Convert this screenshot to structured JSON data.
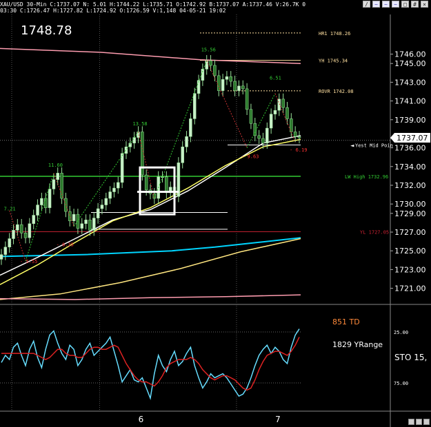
{
  "header": {
    "line1": "XAU/USD 30-Min  C:1737.07  N: 5.01  H:1744.22  L:1735.71  O:1742.92  B:1737.07  A:1737.46  V:26.7K  0",
    "line2": "03:30  C:1726.47  H:1727.82  L:1724.92  O:1726.59  V:1,148  04-05-21  19:02"
  },
  "window_icons": [
    "line-draw-icon",
    "indicator-icon",
    "indicator-icon",
    "indicator-icon",
    "square-icon",
    "grid-icon",
    "close-icon"
  ],
  "big_price": "1748.78",
  "indicator_notes": {
    "td": "851 TD",
    "yrange": "1829 YRange"
  },
  "chart_data": [
    {
      "type": "line",
      "title": "",
      "ylim": [
        1719.5,
        1749.5
      ],
      "y_ticks": [
        "1746.00",
        "1745.00",
        "1743.00",
        "1741.00",
        "1739.00",
        "1737.00",
        "1736.00",
        "1734.00",
        "1732.00",
        "1730.00",
        "1729.00",
        "1727.00",
        "1725.00",
        "1723.00",
        "1721.00"
      ],
      "x_ticks": [
        {
          "label": "6",
          "index": 34
        },
        {
          "label": "7",
          "index": 68
        }
      ],
      "n_bars": 75,
      "current_price": {
        "label": "1737.07",
        "value": 1737.07
      },
      "candles_close": [
        1724.6,
        1725.4,
        1726.3,
        1727.2,
        1727.8,
        1726.9,
        1726.4,
        1727.9,
        1728.8,
        1729.9,
        1730.6,
        1729.6,
        1731.6,
        1732.6,
        1733.3,
        1730.6,
        1729.2,
        1728.2,
        1728.9,
        1727.4,
        1727.9,
        1728.3,
        1727.2,
        1728.5,
        1729.5,
        1729.9,
        1730.6,
        1731.3,
        1731.7,
        1732.3,
        1735.4,
        1736.1,
        1736.5,
        1737.1,
        1737.7,
        1733.1,
        1731.5,
        1731.1,
        1730.6,
        1732.9,
        1732.9,
        1731.2,
        1731.8,
        1730.8,
        1734.4,
        1736.1,
        1737.2,
        1739.1,
        1741.8,
        1743.2,
        1744.4,
        1745.3,
        1744.8,
        1743.7,
        1742.1,
        1743.3,
        1743.6,
        1743.1,
        1742.1,
        1742.6,
        1742.3,
        1740.1,
        1738.6,
        1737.3,
        1737.0,
        1736.5,
        1738.1,
        1739.6,
        1740.0,
        1741.2,
        1740.3,
        1739.1,
        1737.7,
        1737.2,
        1737.07
      ],
      "series": [
        {
          "color": "#ff9db0",
          "values": [
            1746.6,
            1746.2,
            1745.4,
            1745.0
          ]
        },
        {
          "color": "#00d5ff",
          "values": [
            1724.4,
            1724.5,
            1724.6,
            1724.8,
            1725.0,
            1725.4,
            1725.9,
            1726.4
          ]
        },
        {
          "color": "#ffe680",
          "values": [
            1719.8,
            1720.4,
            1721.6,
            1723.1,
            1724.9,
            1726.3
          ]
        },
        {
          "color": "#ffffff",
          "values": [
            1722.4,
            1724.3,
            1726.3,
            1728.3,
            1729.4,
            1731.4,
            1733.9,
            1736.5,
            1737.3
          ]
        },
        {
          "color": "#ffff66",
          "values": [
            1721.4,
            1723.5,
            1725.9,
            1728.2,
            1729.6,
            1731.7,
            1734.1,
            1736.1,
            1736.9
          ]
        },
        {
          "color": "#ff9db0",
          "values": [
            1719.9,
            1719.8,
            1720.0,
            1720.1,
            1720.3
          ]
        }
      ],
      "levels": [
        {
          "label": "HR1 1748.26",
          "value": 1748.26,
          "color": "#ffe0a0"
        },
        {
          "label": "YH 1745.34",
          "value": 1745.34,
          "color": "#ffe0a0"
        },
        {
          "label": "ROVR 1742.08",
          "value": 1742.08,
          "color": "#ffe0a0"
        },
        {
          "label": "Yest Mid Poin",
          "value": 1736.3,
          "color": "#ffffff"
        },
        {
          "label": "LW High 1732.96",
          "value": 1732.96,
          "color": "#33cc33"
        },
        {
          "label": "YL 1727.05",
          "value": 1727.05,
          "color": "#cc2233"
        }
      ],
      "annotations": [
        {
          "text": "15.56",
          "x": 51,
          "y": 1746.3,
          "color": "#33cc33"
        },
        {
          "text": "6.51",
          "x": 68,
          "y": 1743.3,
          "color": "#33cc33"
        },
        {
          "text": "13.58",
          "x": 34,
          "y": 1738.4,
          "color": "#33cc33"
        },
        {
          "text": "11.60",
          "x": 13,
          "y": 1734.0,
          "color": "#33cc33"
        },
        {
          "text": "7.21",
          "x": 2,
          "y": 1729.3,
          "color": "#33cc33"
        },
        {
          "text": "- 9.63",
          "x": 61,
          "y": 1734.9,
          "color": "#ff3333"
        },
        {
          "text": "- 6.19",
          "x": 73,
          "y": 1735.6,
          "color": "#ff3333"
        },
        {
          "text": "- 8.35",
          "x": 15,
          "y": 1725.5,
          "color": "#ff3333"
        },
        {
          "text": "- 5.55",
          "x": 6,
          "y": 1723.7,
          "color": "#ff3333"
        }
      ]
    },
    {
      "type": "line",
      "title": "",
      "indicator": "STO",
      "y_ticks": [
        "25.00",
        "75.00"
      ],
      "axis_label": "STO  15,",
      "series": [
        {
          "color": "#66ddff",
          "values": [
            55,
            48,
            52,
            40,
            36,
            48,
            58,
            42,
            34,
            50,
            60,
            42,
            28,
            24,
            36,
            46,
            52,
            38,
            42,
            58,
            52,
            42,
            36,
            48,
            44,
            40,
            36,
            30,
            44,
            58,
            74,
            68,
            62,
            72,
            74,
            70,
            80,
            90,
            66,
            48,
            58,
            64,
            52,
            44,
            58,
            54,
            46,
            40,
            58,
            70,
            80,
            74,
            66,
            70,
            68,
            66,
            70,
            76,
            82,
            88,
            86,
            80,
            70,
            58,
            48,
            42,
            38,
            46,
            40,
            44,
            52,
            56,
            40,
            28,
            22
          ]
        },
        {
          "color": "#dd2222",
          "values": [
            46,
            46,
            46,
            46,
            46,
            46,
            46,
            46,
            46,
            48,
            50,
            52,
            50,
            46,
            42,
            42,
            46,
            48,
            48,
            50,
            50,
            46,
            42,
            40,
            40,
            42,
            42,
            40,
            38,
            40,
            48,
            56,
            62,
            68,
            72,
            74,
            74,
            76,
            78,
            74,
            68,
            60,
            56,
            54,
            52,
            52,
            52,
            50,
            52,
            56,
            62,
            66,
            70,
            72,
            70,
            68,
            68,
            70,
            72,
            76,
            80,
            82,
            80,
            72,
            62,
            54,
            48,
            46,
            44,
            44,
            46,
            48,
            44,
            38,
            30
          ]
        }
      ]
    }
  ]
}
